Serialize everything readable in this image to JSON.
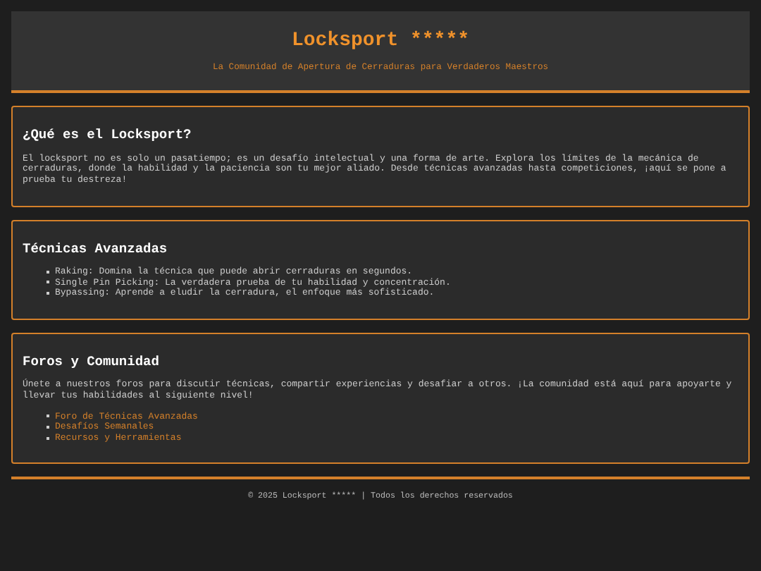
{
  "header": {
    "title": "Locksport *****",
    "tagline": "La Comunidad de Apertura de Cerraduras para Verdaderos Maestros"
  },
  "sections": [
    {
      "heading": "¿Qué es el Locksport?",
      "paragraph": "El locksport no es solo un pasatiempo; es un desafío intelectual y una forma de arte. Explora los límites de la mecánica de cerraduras, donde la habilidad y la paciencia son tu mejor aliado. Desde técnicas avanzadas hasta competiciones, ¡aquí se pone a prueba tu destreza!"
    },
    {
      "heading": "Técnicas Avanzadas",
      "list": [
        {
          "kind": "text",
          "text": "Raking: Domina la técnica que puede abrir cerraduras en segundos."
        },
        {
          "kind": "text",
          "text": "Single Pin Picking: La verdadera prueba de tu habilidad y concentración."
        },
        {
          "kind": "text",
          "text": "Bypassing: Aprende a eludir la cerradura, el enfoque más sofisticado."
        }
      ]
    },
    {
      "heading": "Foros y Comunidad",
      "paragraph": "Únete a nuestros foros para discutir técnicas, compartir experiencias y desafiar a otros. ¡La comunidad está aquí para apoyarte y llevar tus habilidades al siguiente nivel!",
      "list": [
        {
          "kind": "link",
          "text": "Foro de Técnicas Avanzadas"
        },
        {
          "kind": "link",
          "text": "Desafíos Semanales"
        },
        {
          "kind": "link",
          "text": "Recursos y Herramientas"
        }
      ]
    }
  ],
  "footer": "© 2025 Locksport ***** | Todos los derechos reservados"
}
